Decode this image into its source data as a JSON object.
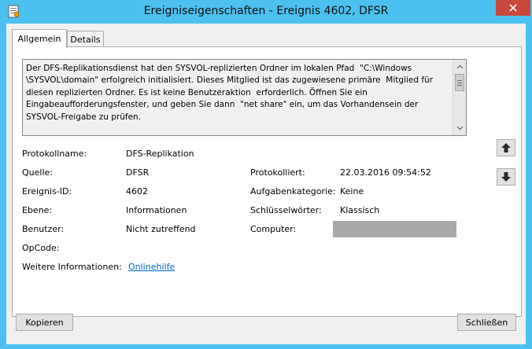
{
  "window": {
    "title": "Ereigniseigenschaften - Ereignis 4602, DFSR"
  },
  "tabs": [
    {
      "label": "Allgemein",
      "active": true
    },
    {
      "label": "Details",
      "active": false
    }
  ],
  "description": "Der DFS-Replikationsdienst hat den SYSVOL-replizierten Ordner im lokalen Pfad  \"C:\\Windows\n\\SYSVOL\\domain\" erfolgreich initialisiert. Dieses Mitglied ist das zugewiesene primäre  Mitglied für\ndiesen replizierten Ordner. Es ist keine Benutzeraktion  erforderlich. Öffnen Sie ein\nEingabeaufforderungsfenster, und geben Sie dann  \"net share\" ein, um das Vorhandensein der\nSYSVOL-Freigabe zu prüfen.",
  "fields": {
    "protokollname": {
      "label": "Protokollname:",
      "value": "DFS-Replikation"
    },
    "quelle": {
      "label": "Quelle:",
      "value": "DFSR"
    },
    "protokolliert": {
      "label": "Protokolliert:",
      "value": "22.03.2016 09:54:52"
    },
    "ereignis_id": {
      "label": "Ereignis-ID:",
      "value": "4602"
    },
    "aufgabenkategorie": {
      "label": "Aufgabenkategorie:",
      "value": "Keine"
    },
    "ebene": {
      "label": "Ebene:",
      "value": "Informationen"
    },
    "schluesselwoerter": {
      "label": "Schlüsselwörter:",
      "value": "Klassisch"
    },
    "benutzer": {
      "label": "Benutzer:",
      "value": "Nicht zutreffend"
    },
    "computer": {
      "label": "Computer:",
      "value": ""
    },
    "opcode": {
      "label": "OpCode:",
      "value": ""
    },
    "weitere": {
      "label": "Weitere Informationen:",
      "link": "Onlinehilfe"
    }
  },
  "buttons": {
    "copy": "Kopieren",
    "close": "Schließen"
  },
  "icons": {
    "app": "event-log-icon",
    "close": "close-icon",
    "up": "arrow-up-icon",
    "down": "arrow-down-icon"
  },
  "colors": {
    "titlebar": "#4cc0ee",
    "close_button": "#c7483b",
    "link": "#0066cc"
  }
}
